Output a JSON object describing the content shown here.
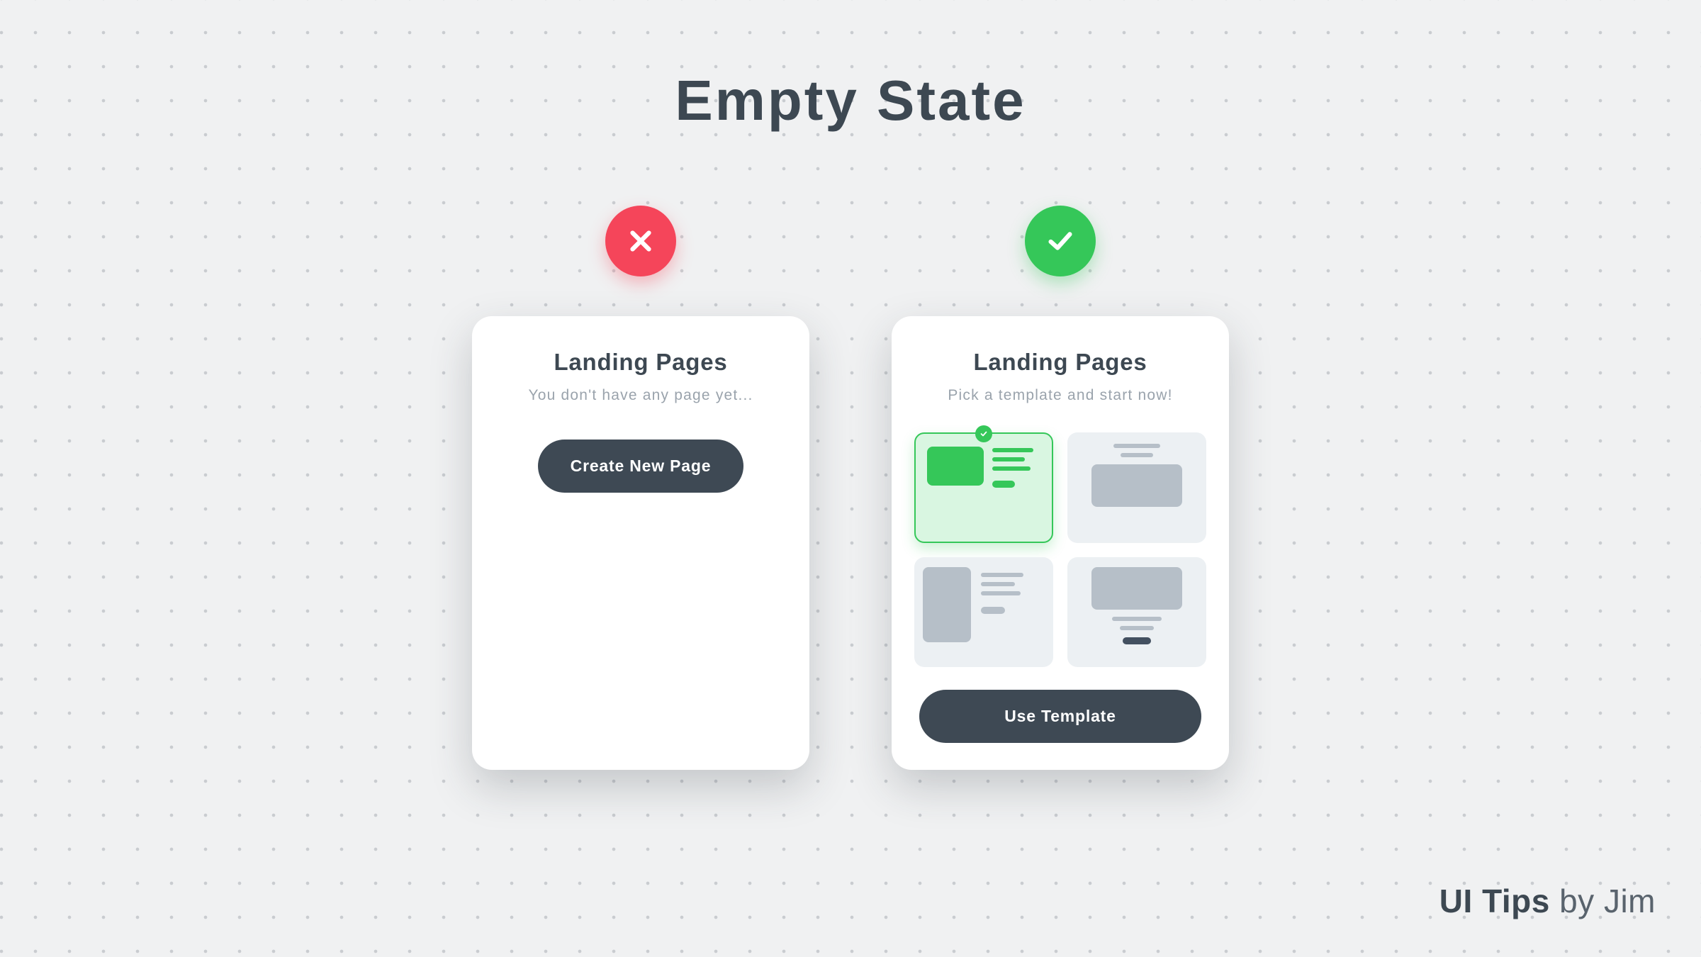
{
  "title": "Empty State",
  "bad_example": {
    "card_title": "Landing Pages",
    "card_subtitle": "You don't have any page yet...",
    "button_label": "Create New Page"
  },
  "good_example": {
    "card_title": "Landing Pages",
    "card_subtitle": "Pick a template and start now!",
    "button_label": "Use Template"
  },
  "footer": {
    "bold": "UI Tips",
    "light": " by Jim"
  },
  "colors": {
    "bad_badge": "#F5455A",
    "good_badge": "#35C759",
    "button": "#3E4954",
    "text_dark": "#3D4852",
    "text_muted": "#9AA3AC"
  }
}
